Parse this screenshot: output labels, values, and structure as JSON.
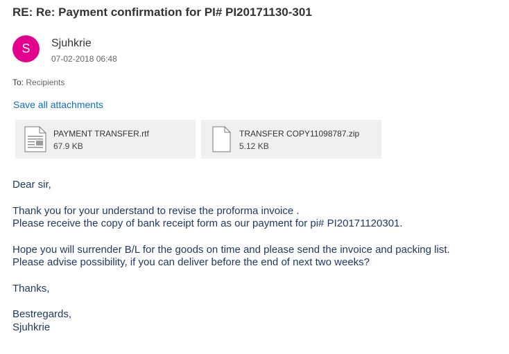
{
  "message": {
    "subject": "RE: Re: Payment confirmation for PI# PI20171130-301",
    "sender": {
      "initial": "S",
      "name": "Sjuhkrie",
      "date": "07-02-2018 06:48",
      "avatar_color": "#e3008c"
    },
    "to_label": "To:",
    "to_value": "Recipients",
    "save_all": "Save all attachments",
    "attachments": [
      {
        "name": "PAYMENT TRANSFER.rtf",
        "size": "67.9 KB",
        "icon": "rtf-document-icon"
      },
      {
        "name": "TRANSFER COPY11098787.zip",
        "size": "5.12 KB",
        "icon": "zip-file-icon"
      }
    ],
    "body": {
      "greeting": "Dear sir,",
      "p1_l1": "Thank you for your understand to revise the proforma invoice .",
      "p1_l2": "Please receive the copy of bank receipt form as our payment for pi# PI20171120301.",
      "p2_l1": "Hope you will surrender B/L for the goods on time and please send the invoice and packing list.",
      "p2_l2": "Please advise possibility, if you can deliver before the end of next two weeks?",
      "thanks": "Thanks,",
      "regards": "Bestregards,",
      "signature": "Sjuhkrie"
    }
  },
  "colors": {
    "link": "#106ebe",
    "body_text": "#1f3864",
    "attachment_bg": "#f0f0f0"
  }
}
